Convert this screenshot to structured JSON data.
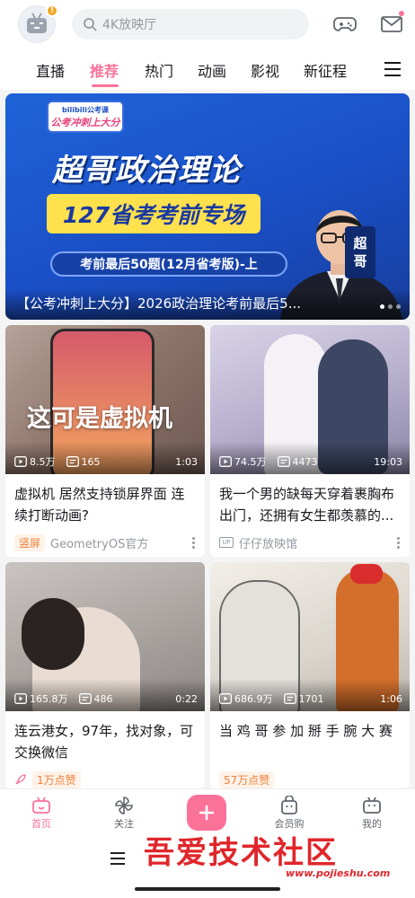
{
  "header": {
    "search_placeholder": "4K放映厅",
    "avatar_icon": "tv-mascot-icon",
    "avatar_badge": "!",
    "game_icon": "gamepad-icon",
    "mail_icon": "mail-icon"
  },
  "tabs": [
    {
      "label": "直播",
      "active": false
    },
    {
      "label": "推荐",
      "active": true
    },
    {
      "label": "热门",
      "active": false
    },
    {
      "label": "动画",
      "active": false
    },
    {
      "label": "影视",
      "active": false
    },
    {
      "label": "新征程",
      "active": false
    }
  ],
  "banner": {
    "brand_top": "bilibili公考课",
    "brand_main": "公考冲刺上大分",
    "title": "超哥政治理论",
    "subtitle": "127省考考前专场",
    "pill": "考前最后50题(12月省考版)-上",
    "tag_line1": "超",
    "tag_line2": "哥",
    "caption": "【公考冲刺上大分】2026政治理论考前最后5..."
  },
  "cards": [
    {
      "overlay_text": "这可是虚拟机",
      "views": "8.5万",
      "danmaku": "165",
      "duration": "1:03",
      "title": "虚拟机 居然支持锁屏界面 连续打断动画?",
      "tag": "竖屏",
      "author": "GeometryOS官方"
    },
    {
      "views": "74.5万",
      "danmaku": "4473",
      "duration": "19:03",
      "title": "我一个男的缺每天穿着裹胸布出门，还拥有女生都羡慕的...",
      "up_badge": "UP",
      "author": "仔仔放映馆"
    },
    {
      "views": "165.8万",
      "danmaku": "486",
      "duration": "0:22",
      "title": "连云港女，97年，找对象，可交换微信",
      "tag": "1万点赞"
    },
    {
      "views": "686.9万",
      "danmaku": "1701",
      "duration": "1:06",
      "title": "当 鸡 哥 参 加 掰 手 腕 大 赛",
      "tag": "57万点赞"
    }
  ],
  "bottom_nav": [
    {
      "label": "首页",
      "icon": "home-tv-icon",
      "active": true
    },
    {
      "label": "关注",
      "icon": "pinwheel-icon",
      "active": false
    },
    {
      "label": "会员购",
      "icon": "shopping-bag-icon",
      "active": false
    },
    {
      "label": "我的",
      "icon": "profile-tv-icon",
      "active": false
    }
  ],
  "watermark": {
    "text": "吾爱技术社区",
    "url": "www.pojieshu.com"
  },
  "colors": {
    "accent": "#fb7299",
    "banner_blue": "#1a4fc6",
    "banner_yellow": "#ffe14d"
  }
}
